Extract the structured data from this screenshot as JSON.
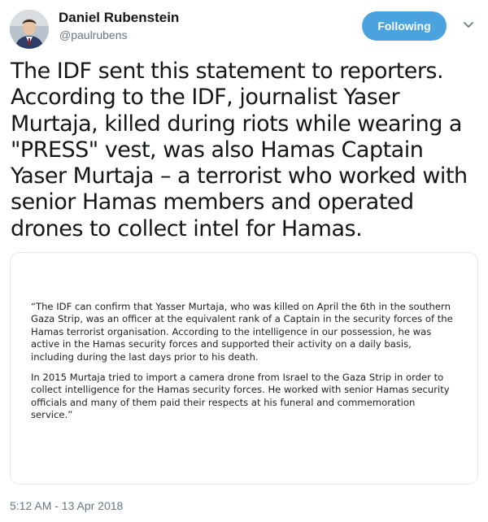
{
  "author": {
    "display_name": "Daniel Rubenstein",
    "handle": "@paulrubens",
    "follow_label": "Following"
  },
  "tweet": {
    "text": "The IDF sent this statement to reporters. According to the IDF, journalist Yaser Murtaja, killed during riots while wearing a \"PRESS\" vest, was also Hamas Captain Yaser Murtaja – a terrorist who worked with senior Hamas members and operated drones to collect intel for Hamas.",
    "timestamp": "5:12 AM - 13 Apr 2018"
  },
  "media": {
    "paragraph_1": "“The IDF can confirm that Yasser Murtaja, who was killed on April the 6th in the southern Gaza Strip, was an officer at the equivalent rank of a Captain in the security forces of the Hamas terrorist organisation. According to the intelligence in our possession, he was active in the Hamas security forces and supported their activity on a daily basis, including during the last days prior to his death.",
    "paragraph_2": "In 2015 Murtaja tried to import a camera drone from Israel to the Gaza Strip in order to collect intelligence for the Hamas security forces. He worked with senior Hamas security officials and many of them paid their respects at his funeral and commemoration service.”"
  },
  "colors": {
    "accent": "#4aa3df",
    "secondary_text": "#657786",
    "border": "#e1e8ed"
  },
  "icons": [
    "avatar",
    "chevron-down-icon"
  ]
}
